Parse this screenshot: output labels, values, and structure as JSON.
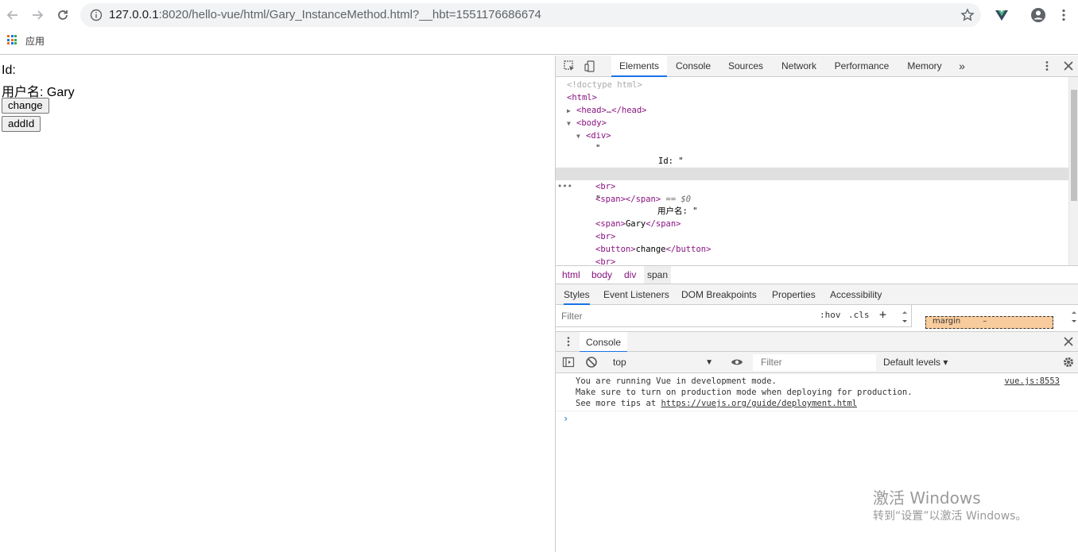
{
  "browser": {
    "url_host": "127.0.0.1",
    "url_rest": ":8020/hello-vue/html/Gary_InstanceMethod.html?__hbt=1551176686674",
    "bookmarks_apps_label": "应用"
  },
  "page": {
    "id_line": "Id:",
    "username_line": "用户名: Gary",
    "change_button": "change",
    "addid_button": "addId"
  },
  "devtools": {
    "tabs": [
      "Elements",
      "Console",
      "Sources",
      "Network",
      "Performance",
      "Memory"
    ],
    "more_tabs": "»",
    "dom": {
      "doctype": "<!doctype html>",
      "html_open": "<html>",
      "head": "<head>…</head>",
      "body_open": "<body>",
      "div_open": "<div>",
      "quote1": "\"",
      "id_text": "Id: \"",
      "span_empty": "<span></span>",
      "eq_marker": " == $0",
      "br1": "<br>",
      "quote2": "\"",
      "username_text": "用户名: \"",
      "span_gary_open": "<span>",
      "span_gary_text": "Gary",
      "span_gary_close": "</span>",
      "br2": "<br>",
      "button_open": "<button>",
      "button_text": "change",
      "button_close": "</button>",
      "br3": "<br>",
      "dots": "•••"
    },
    "breadcrumbs": [
      "html",
      "body",
      "div",
      "span"
    ],
    "styles_tabs": [
      "Styles",
      "Event Listeners",
      "DOM Breakpoints",
      "Properties",
      "Accessibility"
    ],
    "styles_filter_placeholder": "Filter",
    "hov_label": ":hov",
    "cls_label": ".cls",
    "plus_label": "+",
    "box_margin_label": "margin",
    "box_margin_value": "–",
    "drawer_tab": "Console",
    "console": {
      "context": "top",
      "filter_placeholder": "Filter",
      "levels": "Default levels ▾",
      "msg_line1": "You are running Vue in development mode.",
      "msg_line2": "Make sure to turn on production mode when deploying for production.",
      "msg_line3_prefix": "See more tips at ",
      "msg_link": "https://vuejs.org/guide/deployment.html",
      "msg_source": "vue.js:8553",
      "prompt": "›"
    }
  },
  "watermark": {
    "line1": "激活 Windows",
    "line2": "转到“设置”以激活 Windows。"
  },
  "colors": {
    "devtools_tag": "#881280",
    "accent_blue": "#1a73e8",
    "box_margin": "#f9cc9d",
    "selected_row": "#e0e0e0"
  }
}
